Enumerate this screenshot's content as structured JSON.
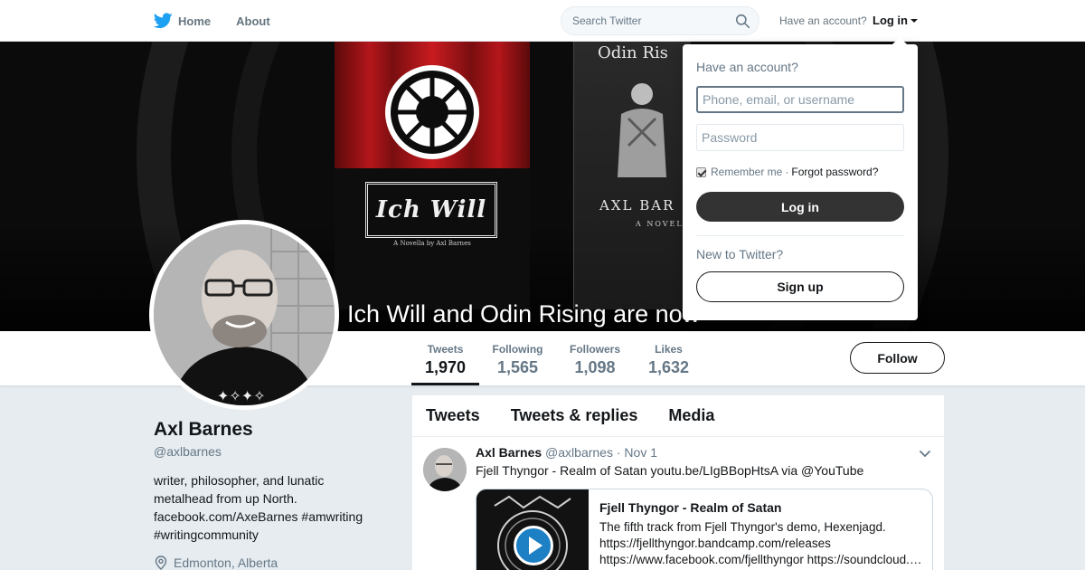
{
  "nav": {
    "home_label": "Home",
    "about_label": "About",
    "search_placeholder": "Search Twitter",
    "have_account_text": "Have an account?",
    "login_label": "Log in"
  },
  "banner": {
    "book1_title": "Ich Will",
    "book1_subtitle": "A Novella by Axl Barnes",
    "book2_title": "Odin Ris",
    "book2_author": "AXL BAR",
    "book2_tag": "A NOVEL",
    "caption": "Ich Will and Odin Rising are now"
  },
  "stats": [
    {
      "label": "Tweets",
      "value": "1,970"
    },
    {
      "label": "Following",
      "value": "1,565"
    },
    {
      "label": "Followers",
      "value": "1,098"
    },
    {
      "label": "Likes",
      "value": "1,632"
    }
  ],
  "follow_label": "Follow",
  "profile": {
    "name": "Axl Barnes",
    "handle": "@axlbarnes",
    "bio_lines": [
      "writer, philosopher, and lunatic",
      "metalhead from up North.",
      "facebook.com/AxeBarnes #amwriting",
      "#writingcommunity"
    ],
    "location": "Edmonton, Alberta"
  },
  "timeline": {
    "tabs": [
      "Tweets",
      "Tweets & replies",
      "Media"
    ],
    "tweet": {
      "name": "Axl Barnes",
      "handle": "@axlbarnes",
      "dot": "·",
      "time": "Nov 1",
      "text": "Fjell Thyngor - Realm of Satan youtu.be/LIgBBopHtsA via @YouTube",
      "card_title": "Fjell Thyngor - Realm of Satan",
      "card_desc_lines": [
        "The fifth track from Fjell Thyngor's demo, Hexenjagd.",
        "https://fjellthyngor.bandcamp.com/releases",
        "https://www.facebook.com/fjellthyngor https://soundcloud.com"
      ]
    }
  },
  "login_dropdown": {
    "heading": "Have an account?",
    "username_placeholder": "Phone, email, or username",
    "password_placeholder": "Password",
    "remember_label": "Remember me",
    "separator": "·",
    "forgot_label": "Forgot password?",
    "login_button": "Log in",
    "new_text": "New to Twitter?",
    "signup_button": "Sign up"
  },
  "colors": {
    "twitter_blue": "#1da1f2",
    "text_primary": "#14171a",
    "text_secondary": "#657786",
    "page_bg": "#e6ecf0"
  }
}
